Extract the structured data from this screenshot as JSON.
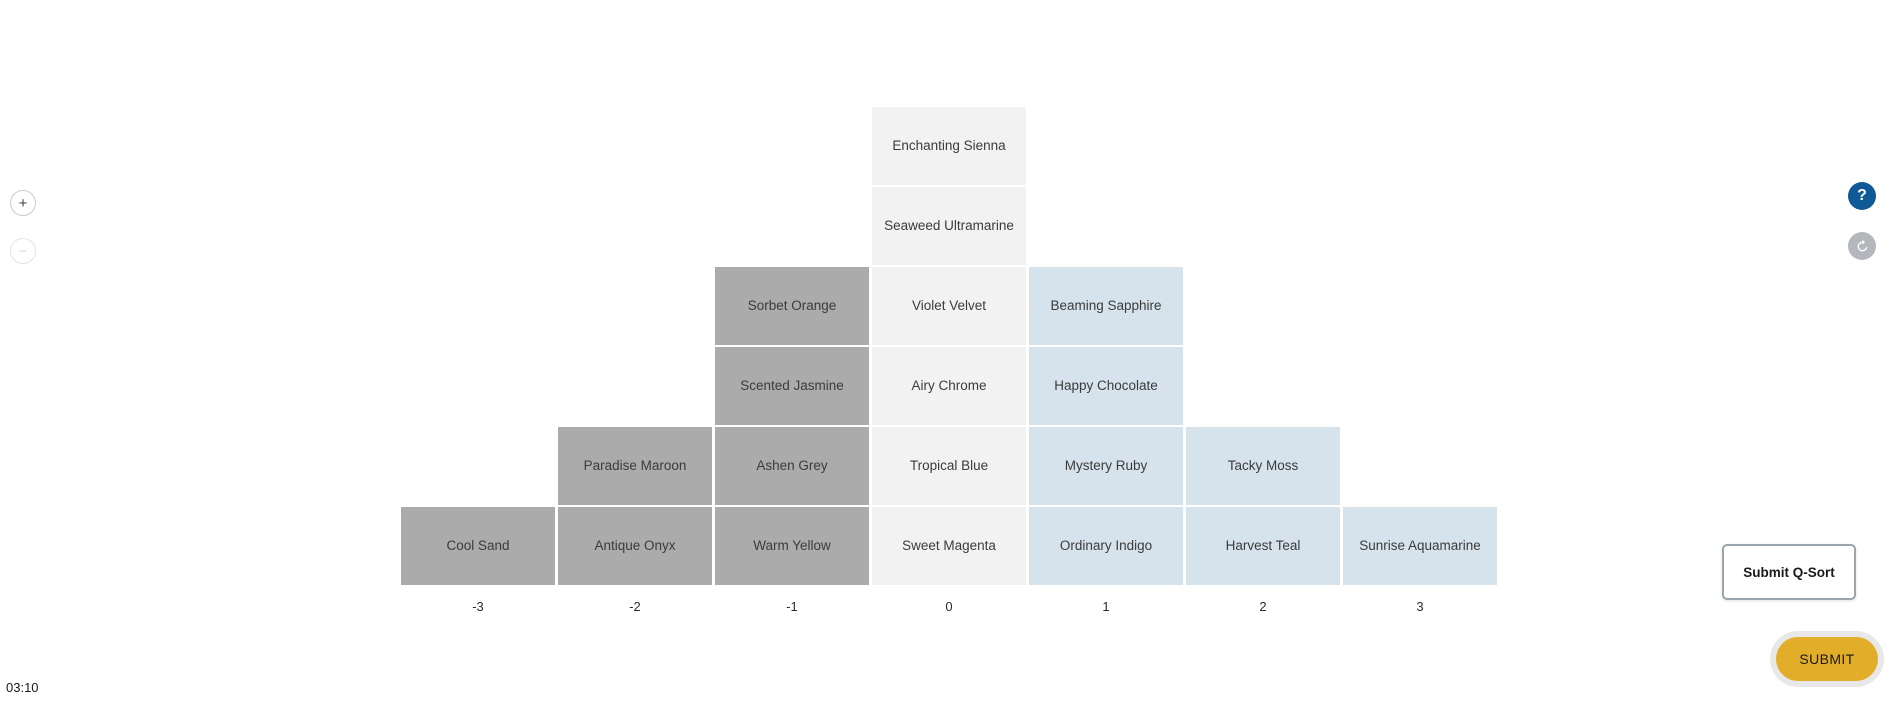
{
  "timer": {
    "value": "03:10"
  },
  "zoom_controls": {
    "zoom_in_label": "+",
    "zoom_out_label": "−"
  },
  "side_controls": {
    "help_label": "?",
    "reset_icon": "refresh-icon"
  },
  "submit": {
    "tooltip_label": "Submit Q-Sort",
    "button_label": "SUBMIT"
  },
  "colors": {
    "negative_card": "#ababab",
    "neutral_card": "#f2f2f2",
    "positive_card": "#d6e3ec",
    "help_button": "#0f5a96",
    "reset_button": "#b4b8bd",
    "submit_button": "#e2ad29",
    "submit_halo": "#e8e8e8",
    "page_background": "#ffffff"
  },
  "qsort": {
    "axis_labels": [
      "-3",
      "-2",
      "-1",
      "0",
      "1",
      "2",
      "3"
    ],
    "columns": [
      {
        "value": "-3",
        "tone": "neg",
        "capacity": 1,
        "cards": [
          "Cool Sand"
        ]
      },
      {
        "value": "-2",
        "tone": "neg",
        "capacity": 2,
        "cards": [
          "Paradise Maroon",
          "Antique Onyx"
        ]
      },
      {
        "value": "-1",
        "tone": "neg",
        "capacity": 4,
        "cards": [
          "Sorbet Orange",
          "Scented Jasmine",
          "Ashen Grey",
          "Warm Yellow"
        ]
      },
      {
        "value": "0",
        "tone": "zero",
        "capacity": 6,
        "cards": [
          "Enchanting Sienna",
          "Seaweed Ultramarine",
          "Violet Velvet",
          "Airy Chrome",
          "Tropical Blue",
          "Sweet Magenta"
        ]
      },
      {
        "value": "1",
        "tone": "pos",
        "capacity": 4,
        "cards": [
          "Beaming Sapphire",
          "Happy Chocolate",
          "Mystery Ruby",
          "Ordinary Indigo"
        ]
      },
      {
        "value": "2",
        "tone": "pos",
        "capacity": 2,
        "cards": [
          "Tacky Moss",
          "Harvest Teal"
        ]
      },
      {
        "value": "3",
        "tone": "pos",
        "capacity": 1,
        "cards": [
          "Sunrise Aquamarine"
        ]
      }
    ]
  }
}
